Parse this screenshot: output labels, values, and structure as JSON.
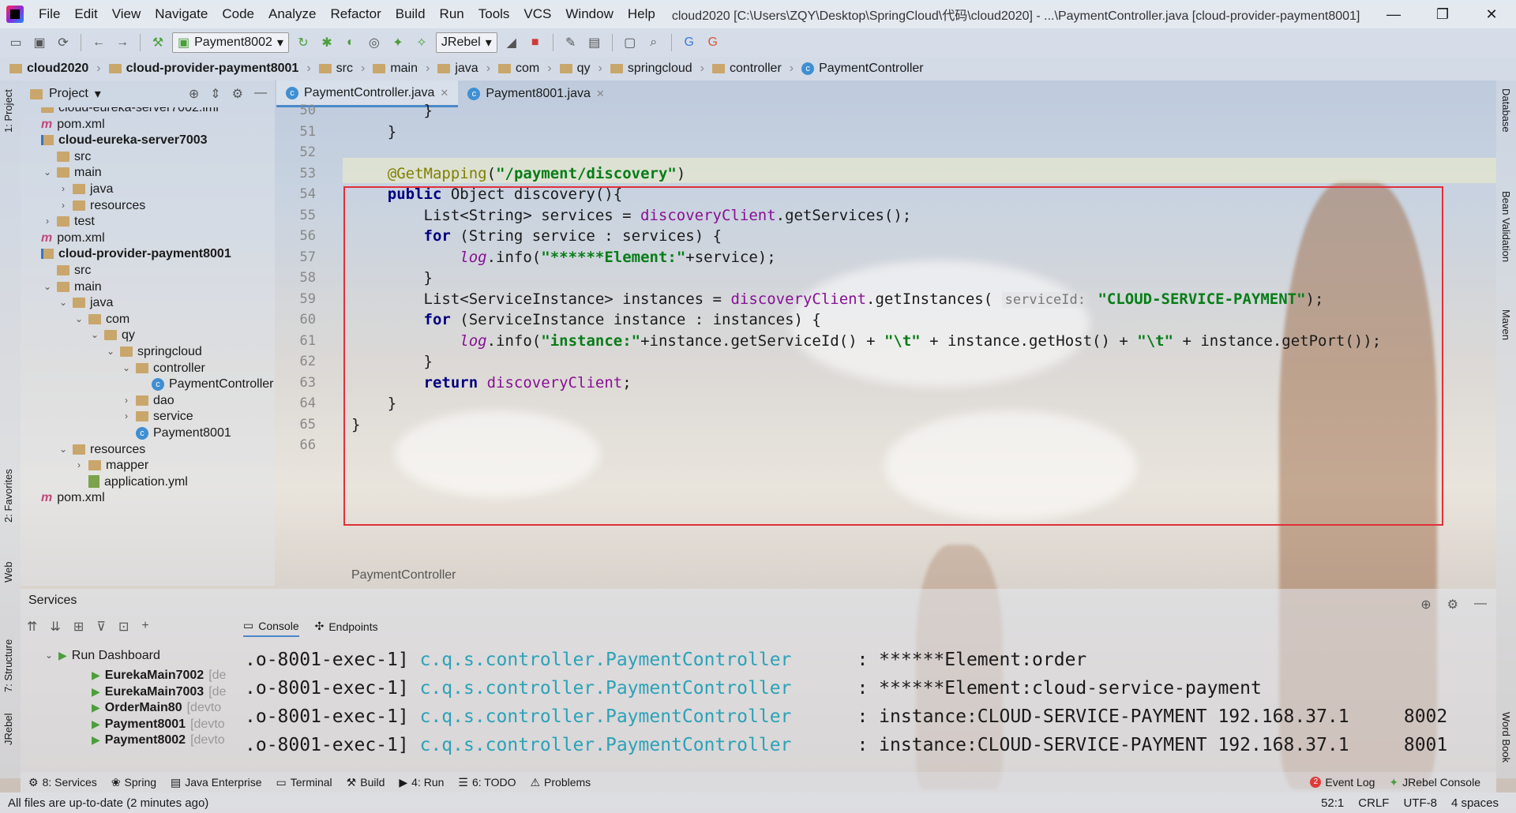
{
  "menu": [
    "File",
    "Edit",
    "View",
    "Navigate",
    "Code",
    "Analyze",
    "Refactor",
    "Build",
    "Run",
    "Tools",
    "VCS",
    "Window",
    "Help"
  ],
  "window_title": "cloud2020 [C:\\Users\\ZQY\\Desktop\\SpringCloud\\代码\\cloud2020] - ...\\PaymentController.java [cloud-provider-payment8001]",
  "window_controls": {
    "minimize": "—",
    "restore": "❐",
    "close": "✕"
  },
  "toolbar": {
    "run_config": "Payment8002",
    "jrebel": "JRebel"
  },
  "breadcrumb": [
    "cloud2020",
    "cloud-provider-payment8001",
    "src",
    "main",
    "java",
    "com",
    "qy",
    "springcloud",
    "controller",
    "PaymentController"
  ],
  "project": {
    "header": "Project",
    "rows": [
      {
        "label": "cloud-eureka-server7002.iml",
        "icon": "iml",
        "depth": 0
      },
      {
        "label": "pom.xml",
        "icon": "m",
        "depth": 0
      },
      {
        "label": "cloud-eureka-server7003",
        "icon": "module",
        "depth": 0
      },
      {
        "label": "src",
        "icon": "folder",
        "depth": 1
      },
      {
        "label": "main",
        "icon": "folder",
        "depth": 1,
        "arrow": "open"
      },
      {
        "label": "java",
        "icon": "folder",
        "depth": 2,
        "arrow": "closed"
      },
      {
        "label": "resources",
        "icon": "folder",
        "depth": 2,
        "arrow": "closed"
      },
      {
        "label": "test",
        "icon": "folder",
        "depth": 1,
        "arrow": "closed"
      },
      {
        "label": "pom.xml",
        "icon": "m",
        "depth": 0
      },
      {
        "label": "cloud-provider-payment8001",
        "icon": "module",
        "depth": 0
      },
      {
        "label": "src",
        "icon": "folder",
        "depth": 1
      },
      {
        "label": "main",
        "icon": "folder",
        "depth": 1,
        "arrow": "open"
      },
      {
        "label": "java",
        "icon": "folder",
        "depth": 2,
        "arrow": "open"
      },
      {
        "label": "com",
        "icon": "folder",
        "depth": 3,
        "arrow": "open"
      },
      {
        "label": "qy",
        "icon": "folder",
        "depth": 4,
        "arrow": "open"
      },
      {
        "label": "springcloud",
        "icon": "folder",
        "depth": 5,
        "arrow": "open"
      },
      {
        "label": "controller",
        "icon": "folder",
        "depth": 6,
        "arrow": "open"
      },
      {
        "label": "PaymentController",
        "icon": "class",
        "depth": 7
      },
      {
        "label": "dao",
        "icon": "folder",
        "depth": 6,
        "arrow": "closed"
      },
      {
        "label": "service",
        "icon": "folder",
        "depth": 6,
        "arrow": "closed"
      },
      {
        "label": "Payment8001",
        "icon": "class",
        "depth": 6
      },
      {
        "label": "resources",
        "icon": "folder",
        "depth": 2,
        "arrow": "open"
      },
      {
        "label": "mapper",
        "icon": "folder",
        "depth": 3,
        "arrow": "closed"
      },
      {
        "label": "application.yml",
        "icon": "yml",
        "depth": 3
      },
      {
        "label": "pom.xml",
        "icon": "m",
        "depth": 0
      }
    ]
  },
  "editor_tabs": [
    {
      "label": "PaymentController.java",
      "active": true
    },
    {
      "label": "Payment8001.java",
      "active": false
    }
  ],
  "code": {
    "line_numbers": [
      "50",
      "51",
      "52",
      "53",
      "54",
      "55",
      "56",
      "57",
      "58",
      "59",
      "60",
      "61",
      "62",
      "63",
      "64",
      "65",
      "66"
    ],
    "lines": [
      [
        {
          "t": "        }",
          "c": ""
        }
      ],
      [
        {
          "t": "    }",
          "c": ""
        }
      ],
      [
        {
          "t": "",
          "c": ""
        }
      ],
      [
        {
          "t": "    ",
          "c": ""
        },
        {
          "t": "@GetMapping",
          "c": "ann"
        },
        {
          "t": "(",
          "c": ""
        },
        {
          "t": "\"/payment/discovery\"",
          "c": "str"
        },
        {
          "t": ")",
          "c": ""
        }
      ],
      [
        {
          "t": "    ",
          "c": ""
        },
        {
          "t": "public",
          "c": "kw"
        },
        {
          "t": " Object discovery(){",
          "c": ""
        }
      ],
      [
        {
          "t": "        List<String> services = ",
          "c": ""
        },
        {
          "t": "discoveryClient",
          "c": "fld"
        },
        {
          "t": ".getServices();",
          "c": ""
        }
      ],
      [
        {
          "t": "        ",
          "c": ""
        },
        {
          "t": "for",
          "c": "kw"
        },
        {
          "t": " (String service : services) {",
          "c": ""
        }
      ],
      [
        {
          "t": "            ",
          "c": ""
        },
        {
          "t": "log",
          "c": "italic-m"
        },
        {
          "t": ".info(",
          "c": ""
        },
        {
          "t": "\"******Element:\"",
          "c": "str"
        },
        {
          "t": "+service);",
          "c": ""
        }
      ],
      [
        {
          "t": "        }",
          "c": ""
        }
      ],
      [
        {
          "t": "        List<ServiceInstance> instances = ",
          "c": ""
        },
        {
          "t": "discoveryClient",
          "c": "fld"
        },
        {
          "t": ".getInstances( ",
          "c": ""
        },
        {
          "t": "serviceId:",
          "c": "hint"
        },
        {
          "t": " ",
          "c": ""
        },
        {
          "t": "\"CLOUD-SERVICE-PAYMENT\"",
          "c": "str"
        },
        {
          "t": ");",
          "c": ""
        }
      ],
      [
        {
          "t": "        ",
          "c": ""
        },
        {
          "t": "for",
          "c": "kw"
        },
        {
          "t": " (ServiceInstance instance : instances) {",
          "c": ""
        }
      ],
      [
        {
          "t": "            ",
          "c": ""
        },
        {
          "t": "log",
          "c": "italic-m"
        },
        {
          "t": ".info(",
          "c": ""
        },
        {
          "t": "\"instance:\"",
          "c": "str"
        },
        {
          "t": "+instance.getServiceId() + ",
          "c": ""
        },
        {
          "t": "\"\\t\"",
          "c": "str"
        },
        {
          "t": " + instance.getHost() + ",
          "c": ""
        },
        {
          "t": "\"\\t\"",
          "c": "str"
        },
        {
          "t": " + instance.getPort());",
          "c": ""
        }
      ],
      [
        {
          "t": "        }",
          "c": ""
        }
      ],
      [
        {
          "t": "        ",
          "c": ""
        },
        {
          "t": "return",
          "c": "kw"
        },
        {
          "t": " ",
          "c": ""
        },
        {
          "t": "discoveryClient",
          "c": "fld"
        },
        {
          "t": ";",
          "c": ""
        }
      ],
      [
        {
          "t": "    }",
          "c": ""
        }
      ],
      [
        {
          "t": "}",
          "c": ""
        }
      ],
      [
        {
          "t": "",
          "c": ""
        }
      ]
    ],
    "footer_crumb": "PaymentController"
  },
  "services": {
    "title": "Services",
    "dashboard": "Run Dashboard",
    "apps": [
      {
        "name": "EurekaMain7002",
        "sub": "[de"
      },
      {
        "name": "EurekaMain7003",
        "sub": "[de"
      },
      {
        "name": "OrderMain80",
        "sub": "[devto"
      },
      {
        "name": "Payment8001",
        "sub": "[devto"
      },
      {
        "name": "Payment8002",
        "sub": "[devto"
      }
    ],
    "console_tabs": [
      "Console",
      "Endpoints"
    ],
    "console": [
      {
        "thread": ".o-8001-exec-1]",
        "logger": "c.q.s.controller.PaymentController",
        "msg": ": ******Element:order"
      },
      {
        "thread": ".o-8001-exec-1]",
        "logger": "c.q.s.controller.PaymentController",
        "msg": ": ******Element:cloud-service-payment"
      },
      {
        "thread": ".o-8001-exec-1]",
        "logger": "c.q.s.controller.PaymentController",
        "msg": ": instance:CLOUD-SERVICE-PAYMENT 192.168.37.1     8002"
      },
      {
        "thread": ".o-8001-exec-1]",
        "logger": "c.q.s.controller.PaymentController",
        "msg": ": instance:CLOUD-SERVICE-PAYMENT 192.168.37.1     8001"
      }
    ]
  },
  "bottom_tabs": [
    "8: Services",
    "Spring",
    "Java Enterprise",
    "Terminal",
    "Build",
    "4: Run",
    "6: TODO",
    "Problems"
  ],
  "bottom_right": {
    "event_log": "Event Log",
    "event_count": "2",
    "jrebel_console": "JRebel Console"
  },
  "left_tabs": [
    "1: Project",
    "2: Favorites",
    "Web",
    "7: Structure",
    "JRebel"
  ],
  "right_tabs": [
    "Database",
    "Bean Validation",
    "Maven",
    "Word Book"
  ],
  "status": {
    "message": "All files are up-to-date (2 minutes ago)",
    "position": "52:1",
    "line_sep": "CRLF",
    "encoding": "UTF-8",
    "indent": "4 spaces"
  }
}
